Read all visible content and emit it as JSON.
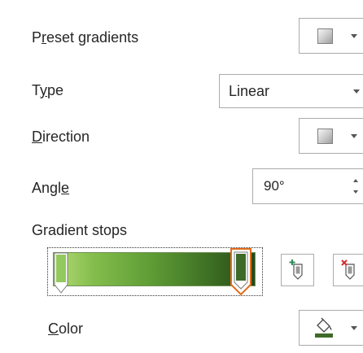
{
  "preset_gradients": {
    "label_pre": "P",
    "label_ul": "r",
    "label_post": "eset gradients",
    "icon": "gradient-swatch-icon"
  },
  "type": {
    "label_pre": "T",
    "label_ul": "y",
    "label_post": "pe",
    "value": "Linear"
  },
  "direction": {
    "label_pre": "",
    "label_ul": "D",
    "label_post": "irection",
    "icon": "gradient-swatch-icon"
  },
  "angle": {
    "label_pre": "Angl",
    "label_ul": "e",
    "label_post": "",
    "value": "90°"
  },
  "gradient_stops": {
    "label": "Gradient stops",
    "start_color": "#a9d66c",
    "end_color": "#2e5a1a",
    "selected_stop_color": "#3d6a28",
    "selected_border": "#e46c1b",
    "stops": [
      {
        "position_percent": 0,
        "color": "#93c95e",
        "selected": false
      },
      {
        "position_percent": 100,
        "color": "#3d6a28",
        "selected": true
      }
    ],
    "add_icon": "add-gradient-stop-icon",
    "remove_icon": "remove-gradient-stop-icon"
  },
  "color": {
    "label_pre": "",
    "label_ul": "C",
    "label_post": "olor",
    "icon": "paint-bucket-icon",
    "current_color": "#3d6a28"
  }
}
